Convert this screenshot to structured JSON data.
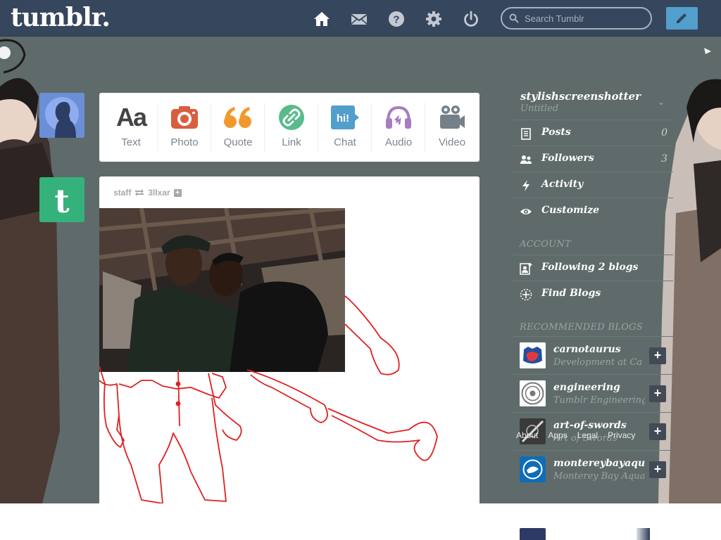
{
  "header": {
    "logo": "tumblr.",
    "search_placeholder": "Search Tumblr",
    "nav_icons": [
      "home-icon",
      "mail-icon",
      "help-icon",
      "gear-icon",
      "power-icon"
    ],
    "compose_icon": "pencil-icon"
  },
  "post_types": [
    {
      "label": "Text",
      "icon": "text-icon",
      "color": "#444444"
    },
    {
      "label": "Photo",
      "icon": "camera-icon",
      "color": "#d95e40"
    },
    {
      "label": "Quote",
      "icon": "quote-icon",
      "color": "#f2992e"
    },
    {
      "label": "Link",
      "icon": "link-icon",
      "color": "#56bc8a"
    },
    {
      "label": "Chat",
      "icon": "chat-icon",
      "color": "#529ecc"
    },
    {
      "label": "Audio",
      "icon": "headphones-icon",
      "color": "#a77dc2"
    },
    {
      "label": "Video",
      "icon": "video-camera-icon",
      "color": "#748089"
    }
  ],
  "post": {
    "author": "staff",
    "reblogged_from": "3llxar"
  },
  "sidebar": {
    "blog_name": "stylishscreenshotter",
    "blog_title": "Untitled",
    "rows": [
      {
        "label": "Posts",
        "count": "0",
        "icon": "posts-icon"
      },
      {
        "label": "Followers",
        "count": "3",
        "icon": "followers-icon"
      },
      {
        "label": "Activity",
        "count": "",
        "icon": "lightning-icon"
      },
      {
        "label": "Customize",
        "count": "",
        "icon": "eye-icon"
      }
    ],
    "account_heading": "ACCOUNT",
    "account_rows": [
      {
        "label": "Following 2 blogs",
        "icon": "following-icon"
      },
      {
        "label": "Find Blogs",
        "icon": "compass-icon"
      }
    ],
    "recommended_heading": "RECOMMENDED BLOGS",
    "recommended": [
      {
        "name": "carnotaurus",
        "desc": "Development at Ca"
      },
      {
        "name": "engineering",
        "desc": "Tumblr Engineering"
      },
      {
        "name": "art-of-swords",
        "desc": "Art of Swords"
      },
      {
        "name": "montereybayaqu",
        "desc": "Monterey Bay Aqua"
      }
    ],
    "footer_links": [
      "About",
      "Apps",
      "Legal",
      "Privacy"
    ]
  },
  "colors": {
    "header_bg": "#36465d",
    "compose_bg": "#529ecc",
    "page_bg": "#5f6b6a",
    "staff_avatar": "#35b27b"
  }
}
